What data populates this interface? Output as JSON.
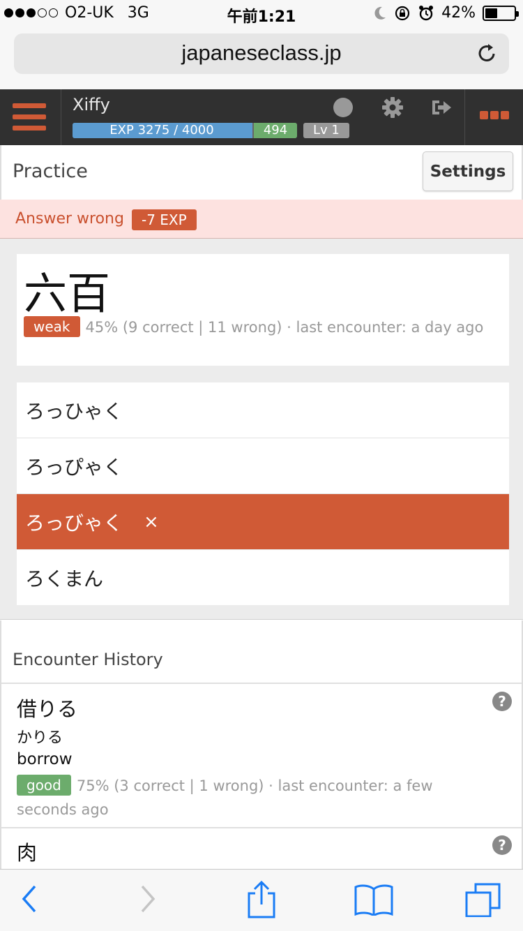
{
  "status_bar": {
    "carrier": "O2-UK",
    "network": "3G",
    "time": "午前1:21",
    "battery": "42%",
    "battery_level": 0.42,
    "signal_bars_filled": 3,
    "signal_bars_total": 5
  },
  "browser": {
    "url": "japaneseclass.jp"
  },
  "app_header": {
    "username": "Xiffy",
    "exp_text": "EXP 3275 / 4000",
    "exp_fraction": 0.8,
    "points": "494",
    "level": "Lv 1",
    "accent_color": "#d05a36"
  },
  "practice": {
    "title": "Practice",
    "settings_label": "Settings"
  },
  "alert": {
    "message": "Answer wrong",
    "badge": "-7 EXP"
  },
  "question": {
    "kanji": "六百",
    "tag": "weak",
    "stats": "45% (9 correct | 11 wrong)  ·  last encounter: a day ago"
  },
  "choices": [
    {
      "text": "ろっひゃく",
      "state": "normal"
    },
    {
      "text": "ろっぴゃく",
      "state": "normal"
    },
    {
      "text": "ろっびゃく",
      "state": "wrong",
      "mark": "×"
    },
    {
      "text": "ろくまん",
      "state": "normal"
    }
  ],
  "history": {
    "title": "Encounter History",
    "entries": [
      {
        "kanji": "借りる",
        "reading": "かりる",
        "meaning": "borrow",
        "tag": "good",
        "stats": "75% (3 correct | 1 wrong)  ·  last encounter: a few seconds ago",
        "help": "?"
      },
      {
        "kanji": "肉",
        "help": "?"
      }
    ]
  },
  "toolbar": {
    "icons": [
      "back-icon",
      "forward-icon",
      "share-icon",
      "bookmarks-icon",
      "tabs-icon"
    ]
  }
}
